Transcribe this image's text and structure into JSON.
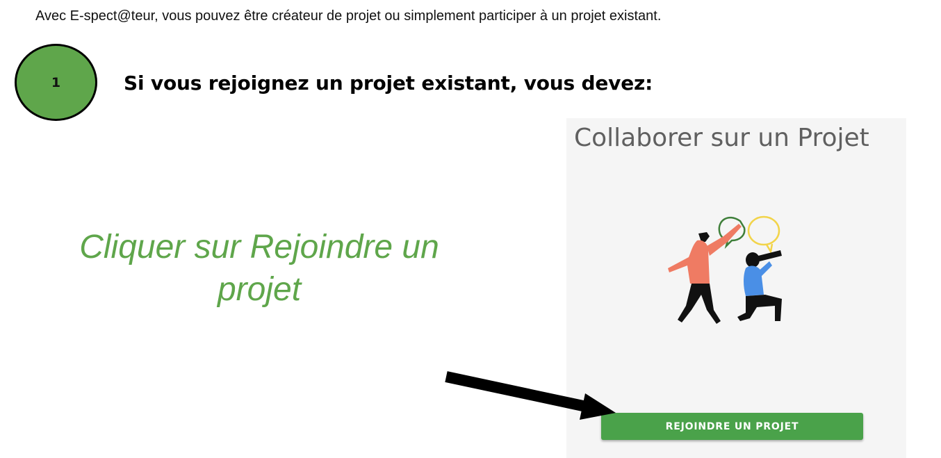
{
  "intro_text": "Avec E-spect@teur, vous pouvez être créateur de projet ou simplement participer à un projet existant.",
  "step": {
    "number": "1",
    "heading": "Si vous rejoignez un projet existant, vous devez:"
  },
  "instruction": {
    "line1": "Cliquer sur Rejoindre un",
    "line2": "projet"
  },
  "card": {
    "title": "Collaborer sur un Projet",
    "button_label": "REJOINDRE UN PROJET"
  },
  "colors": {
    "accent_green": "#5fa64b",
    "button_green": "#4aa24a",
    "card_background": "#f5f5f5"
  },
  "icons": [
    "collaboration-illustration",
    "pointer-arrow-icon"
  ]
}
